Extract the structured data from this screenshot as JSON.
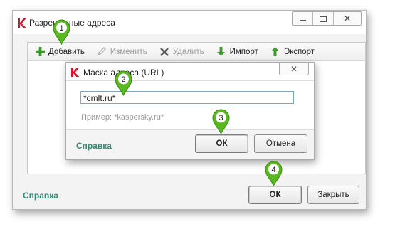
{
  "window": {
    "title": "Разрешенные адреса",
    "controls": {
      "minimize_icon": "minimize-icon",
      "maximize_icon": "maximize-icon",
      "close_icon": "close-icon",
      "close_glyph": "✕"
    }
  },
  "toolbar": {
    "add": "Добавить",
    "edit": "Изменить",
    "delete": "Удалить",
    "import": "Импорт",
    "export": "Экспорт"
  },
  "dialog": {
    "title": "Маска адреса (URL)",
    "input_value": "*cmlt.ru*",
    "hint": "Пример: *kaspersky.ru*",
    "help_link": "Справка",
    "ok_label": "ОК",
    "cancel_label": "Отмена",
    "close_glyph": "✕"
  },
  "footer": {
    "help_link": "Справка",
    "ok_label": "ОК",
    "close_label": "Закрыть"
  },
  "markers": [
    "1",
    "2",
    "3",
    "4"
  ],
  "colors": {
    "marker_green": "#5ab820",
    "link_green": "#2e8b73",
    "brand_red": "#d6162a"
  }
}
